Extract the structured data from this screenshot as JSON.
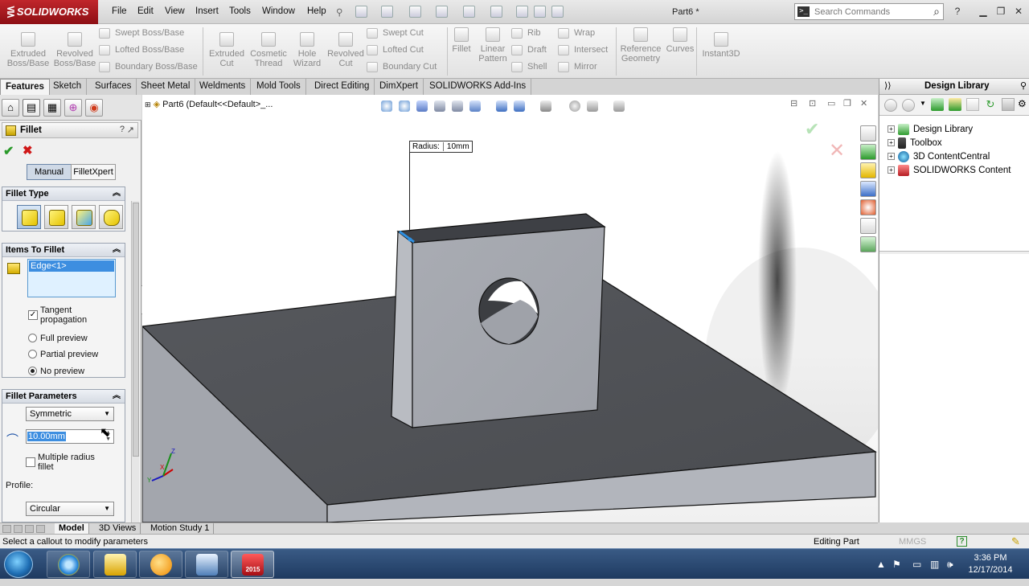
{
  "app": {
    "logo": "SOLIDWORKS",
    "doc_title": "Part6 *"
  },
  "menu": [
    "File",
    "Edit",
    "View",
    "Insert",
    "Tools",
    "Window",
    "Help"
  ],
  "search": {
    "placeholder": "Search Commands"
  },
  "ribbon": {
    "big": [
      {
        "label": "Extruded Boss/Base",
        "l1": "Extruded",
        "l2": "Boss/Base"
      },
      {
        "label": "Revolved Boss/Base",
        "l1": "Revolved",
        "l2": "Boss/Base"
      },
      {
        "label": "Extruded Cut",
        "l1": "Extruded",
        "l2": "Cut"
      },
      {
        "label": "Cosmetic Thread",
        "l1": "Cosmetic",
        "l2": "Thread"
      },
      {
        "label": "Hole Wizard",
        "l1": "Hole",
        "l2": "Wizard"
      },
      {
        "label": "Revolved Cut",
        "l1": "Revolved",
        "l2": "Cut"
      },
      {
        "label": "Fillet",
        "l1": "Fillet",
        "l2": ""
      },
      {
        "label": "Linear Pattern",
        "l1": "Linear",
        "l2": "Pattern"
      },
      {
        "label": "Reference Geometry",
        "l1": "Reference",
        "l2": "Geometry"
      },
      {
        "label": "Curves",
        "l1": "Curves",
        "l2": ""
      },
      {
        "label": "Instant3D",
        "l1": "Instant3D",
        "l2": ""
      }
    ],
    "small": {
      "col1": [
        "Swept Boss/Base",
        "Lofted Boss/Base",
        "Boundary Boss/Base"
      ],
      "col2": [
        "Swept Cut",
        "Lofted Cut",
        "Boundary Cut"
      ],
      "col3": [
        "Rib",
        "Draft",
        "Shell"
      ],
      "col4": [
        "Wrap",
        "Intersect",
        "Mirror"
      ]
    }
  },
  "command_tabs": [
    "Features",
    "Sketch",
    "Surfaces",
    "Sheet Metal",
    "Weldments",
    "Mold Tools",
    "Direct Editing",
    "DimXpert",
    "SOLIDWORKS Add-Ins"
  ],
  "property_manager": {
    "title": "Fillet",
    "help": "?",
    "mode_tabs": [
      "Manual",
      "FilletXpert"
    ],
    "fillet_type": {
      "header": "Fillet Type"
    },
    "items": {
      "header": "Items To Fillet",
      "edges": [
        "Edge<1>"
      ],
      "tangent_label": "Tangent propagation",
      "tangent_l1": "Tangent",
      "tangent_l2": "propagation",
      "tangent_checked": true,
      "preview_options": [
        "Full preview",
        "Partial preview",
        "No preview"
      ],
      "preview_selected": "No preview"
    },
    "params": {
      "header": "Fillet Parameters",
      "type": "Symmetric",
      "radius": "10.00mm",
      "multiple_radius_l1": "Multiple radius",
      "multiple_radius_l2": "fillet",
      "multiple_radius_checked": false,
      "profile_label": "Profile:",
      "profile": "Circular"
    }
  },
  "viewport": {
    "tree_flyout": "Part6  (Default<<Default>_...",
    "callout_label": "Radius:",
    "callout_value": "10mm",
    "triad": {
      "x": "X",
      "y": "Y",
      "z": "Z"
    }
  },
  "taskpane": {
    "title": "Design Library",
    "items": [
      "Design Library",
      "Toolbox",
      "3D ContentCentral",
      "SOLIDWORKS Content"
    ]
  },
  "bottom_tabs": [
    "Model",
    "3D Views",
    "Motion Study 1"
  ],
  "status": {
    "message": "Select a callout to modify parameters",
    "mode": "Editing Part",
    "units": "MMGS"
  },
  "taskbar": {
    "time": "3:36 PM",
    "date": "12/17/2014",
    "sw_badge": "2015"
  },
  "colors": {
    "logo_red": "#b51c22",
    "accent_blue": "#3d8ee0",
    "part_gray": "#a9acb3",
    "plate_dark": "#55575c",
    "ok_green": "#2a9a2a",
    "cancel_red": "#d01818"
  }
}
